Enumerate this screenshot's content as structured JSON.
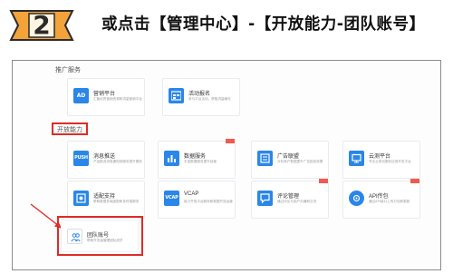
{
  "step": {
    "number": "2",
    "title": "或点击【管理中心】-【开放能力-团队账号】"
  },
  "sections": {
    "promo": "推广服务",
    "open": "开放能力"
  },
  "promo_cards": [
    {
      "icon": "ad-icon",
      "icon_text": "AD",
      "title": "营销平台",
      "desc": "汇聚优质营销资源和流量营销平台"
    },
    {
      "icon": "activity-grid-icon",
      "icon_text": "",
      "title": "活动报名",
      "desc": "参与平台活动，获取流量曝光"
    }
  ],
  "open_cards": [
    {
      "icon": "push-icon",
      "icon_text": "PUSH",
      "title": "消息推送",
      "desc": "产品推送消息通知到服务提升服务",
      "new": false
    },
    {
      "icon": "data-chart-icon",
      "icon_text": "",
      "title": "数据服务",
      "desc": "丰富数据服务提升经营",
      "new": true
    },
    {
      "icon": "ad-union-icon",
      "icon_text": "",
      "title": "广告联盟",
      "desc": "分析商户数据提升广告投放效果",
      "new": false
    },
    {
      "icon": "cloud-monitor-icon",
      "icon_text": "",
      "title": "云测平台",
      "desc": "专业云测试服务应用开发平台",
      "new": false
    },
    {
      "icon": "adapter-icon",
      "icon_text": "",
      "title": "适配支持",
      "desc": "帮助数据多端适配和多终端服务",
      "new": false
    },
    {
      "icon": "vcap-icon",
      "icon_text": "VCAP",
      "title": "VCAP",
      "desc": "能力开放平台服务和数据开放运营",
      "new": false
    },
    {
      "icon": "review-icon",
      "icon_text": "",
      "title": "评论管理",
      "desc": "通过评论与用户沟通和交流",
      "new": true
    },
    {
      "icon": "api-icon",
      "icon_text": "",
      "title": "API传包",
      "desc": "通过API接口上传打包和更新",
      "new": true
    }
  ],
  "team_card": {
    "icon": "team-users-icon",
    "title": "团队账号",
    "desc": "帮助开发者管理团队成员"
  },
  "colors": {
    "accent_blue": "#2a86e8",
    "highlight_red": "#e02b27",
    "badge_orange": "#f3a33a",
    "new_tag": "#f05a4f"
  }
}
